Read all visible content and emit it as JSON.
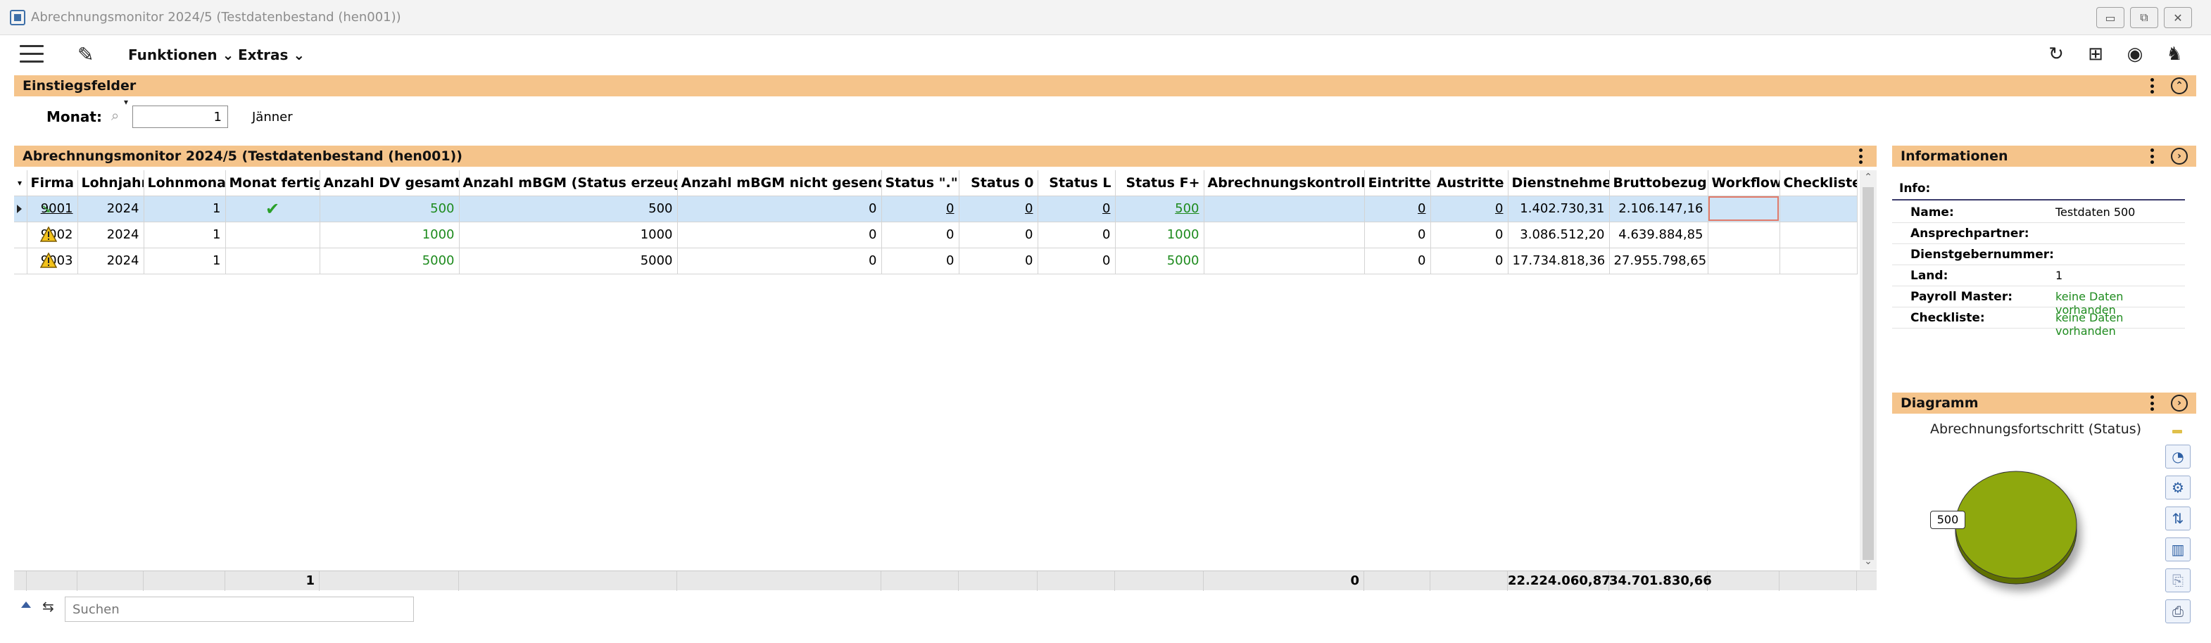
{
  "window": {
    "title": "Abrechnungsmonitor 2024/5 (Testdatenbestand (hen001))",
    "minimize": "▭",
    "restore": "⧉",
    "close": "✕"
  },
  "toolbar": {
    "menu1": "Funktionen",
    "menu2": "Extras"
  },
  "entry": {
    "header": "Einstiegsfelder",
    "monat_label": "Monat:",
    "monat_value": "1",
    "monat_text": "Jänner"
  },
  "grid": {
    "header": "Abrechnungsmonitor 2024/5 (Testdatenbestand (hen001))",
    "columns": [
      "Firma",
      "Lohnjahr",
      "Lohnmonat",
      "Monat fertig",
      "Anzahl DV gesamt",
      "Anzahl mBGM (Status erzeugt)",
      "Anzahl mBGM nicht gesendet",
      "Status \".\"",
      "Status 0",
      "Status L",
      "Status F+",
      "Abrechnungskontrolle",
      "Eintritte",
      "Austritte",
      "Dienstnehmer",
      "Bruttobezug",
      "Workflow",
      "Checkliste"
    ],
    "rows": [
      {
        "firma": "9001",
        "lohnjahr": "2024",
        "lohnmonat": "1",
        "monat_fertig": "✔",
        "dv_gesamt": "500",
        "mbgm_erzeugt": "500",
        "mbgm_nicht": "0",
        "status_dot": "0",
        "status_0": "0",
        "status_l": "0",
        "status_f": "500",
        "kontrolle": "",
        "eintritte": "0",
        "austritte": "0",
        "dienstnehmer": "1.402.730,31",
        "brutto": "2.106.147,16",
        "workflow": "",
        "checkliste": "",
        "status": "ok"
      },
      {
        "firma": "9002",
        "lohnjahr": "2024",
        "lohnmonat": "1",
        "monat_fertig": "",
        "dv_gesamt": "1000",
        "mbgm_erzeugt": "1000",
        "mbgm_nicht": "0",
        "status_dot": "0",
        "status_0": "0",
        "status_l": "0",
        "status_f": "1000",
        "kontrolle": "",
        "eintritte": "0",
        "austritte": "0",
        "dienstnehmer": "3.086.512,20",
        "brutto": "4.639.884,85",
        "workflow": "",
        "checkliste": "",
        "status": "warning"
      },
      {
        "firma": "9003",
        "lohnjahr": "2024",
        "lohnmonat": "1",
        "monat_fertig": "",
        "dv_gesamt": "5000",
        "mbgm_erzeugt": "5000",
        "mbgm_nicht": "0",
        "status_dot": "0",
        "status_0": "0",
        "status_l": "0",
        "status_f": "5000",
        "kontrolle": "",
        "eintritte": "0",
        "austritte": "0",
        "dienstnehmer": "17.734.818,36",
        "brutto": "27.955.798,65",
        "workflow": "",
        "checkliste": "",
        "status": "warning"
      }
    ],
    "totals": {
      "monat_fertig": "1",
      "eintritte": "0",
      "dienstnehmer": "22.224.060,87",
      "brutto": "34.701.830,66"
    }
  },
  "search": {
    "placeholder": "Suchen"
  },
  "info": {
    "header": "Informationen",
    "label": "Info:",
    "rows": [
      {
        "key": "Name:",
        "value": "Testdaten 500"
      },
      {
        "key": "Ansprechpartner:",
        "value": ""
      },
      {
        "key": "Dienstgebernummer:",
        "value": ""
      },
      {
        "key": "Land:",
        "value": "1"
      },
      {
        "key": "Payroll Master:",
        "value": "keine Daten vorhanden"
      },
      {
        "key": "Checkliste:",
        "value": "keine Daten vorhanden"
      }
    ]
  },
  "diagram": {
    "header": "Diagramm",
    "colors": {
      "slice": "#8ea80e",
      "slice_side": "#5e7006"
    }
  },
  "chart_data": {
    "type": "pie",
    "title": "Abrechnungsfortschritt (Status)",
    "categories": [
      ""
    ],
    "values": [
      500
    ],
    "labels": [
      "500"
    ]
  }
}
